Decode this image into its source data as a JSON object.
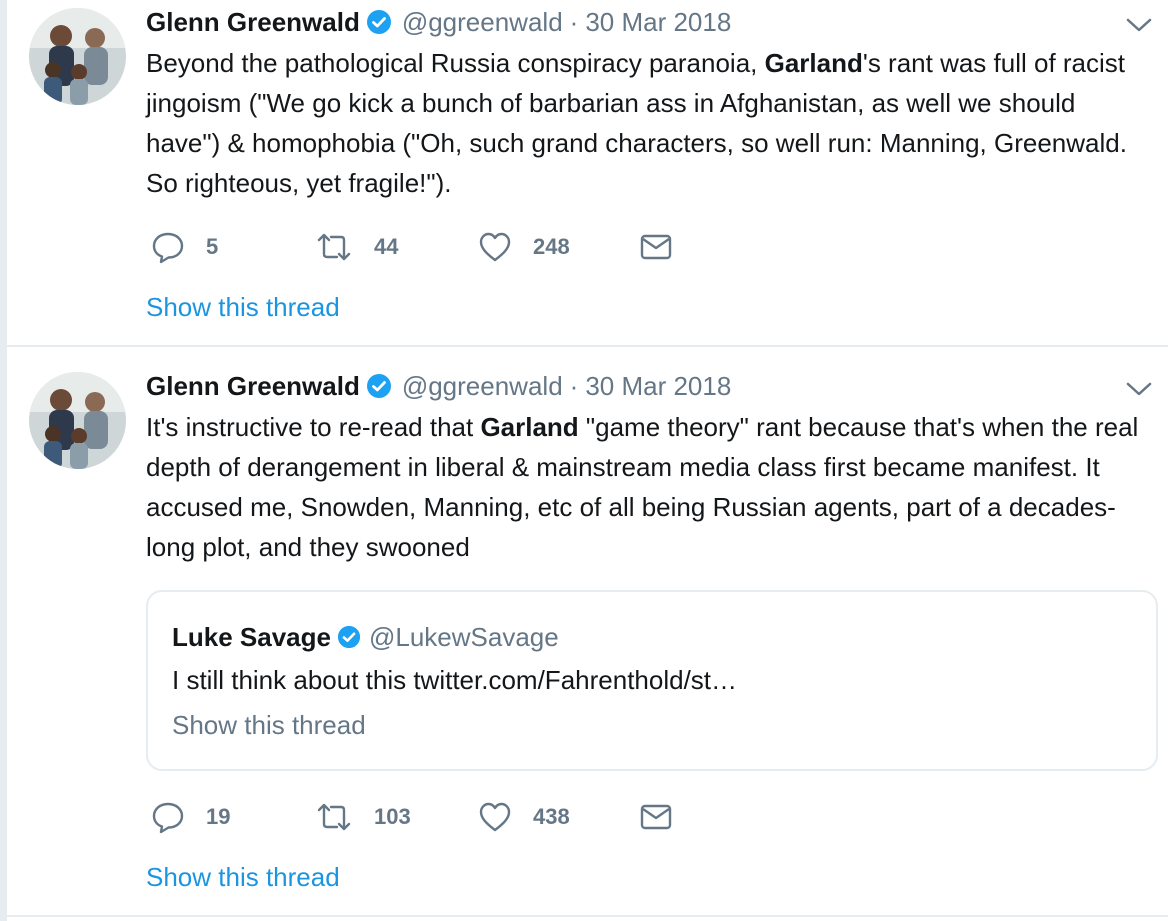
{
  "tweets": [
    {
      "author_name": "Glenn Greenwald",
      "handle": "@ggreenwald",
      "separator": "·",
      "date": "30 Mar 2018",
      "text": "Beyond the pathological Russia conspiracy paranoia, <b>Garland</b>'s rant was full of racist jingoism (\"We go kick a bunch of barbarian ass in Afghanistan, as well we should have\") &amp; homophobia (\"Oh, such grand characters, so well run: Manning, Greenwald. So righteous, yet fragile!\").",
      "replies": "5",
      "retweets": "44",
      "likes": "248",
      "show_thread": "Show this thread"
    },
    {
      "author_name": "Glenn Greenwald",
      "handle": "@ggreenwald",
      "separator": "·",
      "date": "30 Mar 2018",
      "text": "It's instructive to re-read that <b>Garland</b> \"game theory\" rant because that's when the real depth of derangement in liberal &amp; mainstream media class first became manifest. It accused me, Snowden, Manning, etc of all being Russian agents, part of a decades-long plot, and they swooned",
      "quoted": {
        "author_name": "Luke Savage",
        "handle": "@LukewSavage",
        "text": "I still think about this twitter.com/Fahrenthold/st…",
        "show_thread": "Show this thread"
      },
      "replies": "19",
      "retweets": "103",
      "likes": "438",
      "show_thread": "Show this thread"
    }
  ],
  "icons": {
    "reply": "reply-icon",
    "retweet": "retweet-icon",
    "like": "heart-icon",
    "dm": "envelope-icon",
    "verified": "verified-badge-icon",
    "menu": "chevron-down-icon"
  },
  "colors": {
    "link": "#1b95e0",
    "muted": "#657786",
    "verified": "#1da1f2",
    "text": "#14171a",
    "border": "#e6ecf0"
  }
}
